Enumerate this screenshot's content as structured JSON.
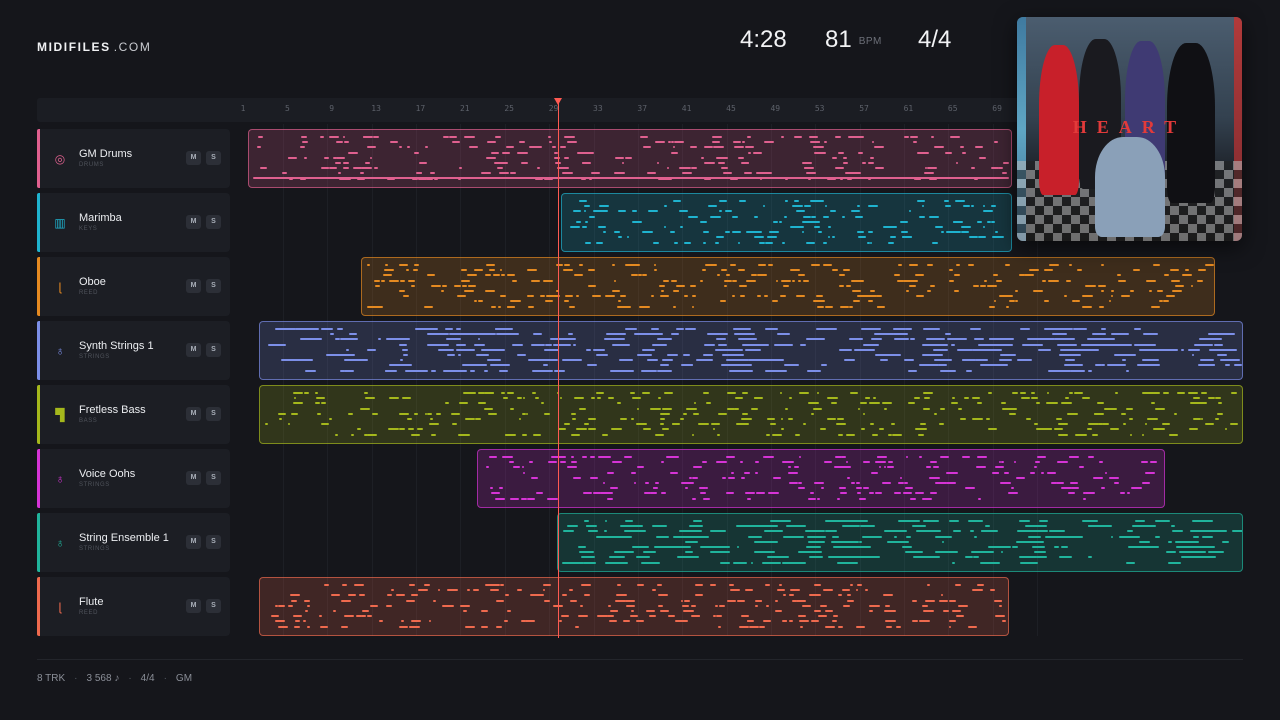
{
  "brand": {
    "name": "MIDIFILES",
    "domain": ".COM"
  },
  "header": {
    "time": "4:28",
    "bpm": "81",
    "bpm_unit": "BPM",
    "time_signature": "4/4"
  },
  "album": {
    "title": "HEART"
  },
  "ruler": {
    "bars": [
      "1",
      "5",
      "9",
      "13",
      "17",
      "21",
      "25",
      "29",
      "33",
      "37",
      "41",
      "45",
      "49",
      "53",
      "57",
      "61",
      "65",
      "69"
    ]
  },
  "playhead_bar": 29,
  "tracks": [
    {
      "name": "GM Drums",
      "category": "DRUMS",
      "color": "#e0608f",
      "icon": "drum-icon",
      "mute": "M",
      "solo": "S",
      "regions": [
        [
          0.008,
          0.77
        ]
      ]
    },
    {
      "name": "Marimba",
      "category": "KEYS",
      "color": "#1fb3cf",
      "icon": "keyboard-icon",
      "mute": "M",
      "solo": "S",
      "regions": [
        [
          0.32,
          0.77
        ]
      ]
    },
    {
      "name": "Oboe",
      "category": "REED",
      "color": "#e58a21",
      "icon": "reed-icon",
      "mute": "M",
      "solo": "S",
      "regions": [
        [
          0.121,
          0.972
        ]
      ]
    },
    {
      "name": "Synth Strings 1",
      "category": "STRINGS",
      "color": "#7c8fe8",
      "icon": "violin-icon",
      "mute": "M",
      "solo": "S",
      "regions": [
        [
          0.019,
          1.0
        ]
      ]
    },
    {
      "name": "Fretless Bass",
      "category": "BASS",
      "color": "#a5b81c",
      "icon": "bass-icon",
      "mute": "M",
      "solo": "S",
      "regions": [
        [
          0.019,
          1.0
        ]
      ]
    },
    {
      "name": "Voice Oohs",
      "category": "STRINGS",
      "color": "#d634d6",
      "icon": "voice-icon",
      "mute": "M",
      "solo": "S",
      "regions": [
        [
          0.236,
          0.922
        ]
      ]
    },
    {
      "name": "String Ensemble 1",
      "category": "STRINGS",
      "color": "#20b49c",
      "icon": "strings-icon",
      "mute": "M",
      "solo": "S",
      "regions": [
        [
          0.316,
          1.0
        ]
      ]
    },
    {
      "name": "Flute",
      "category": "REED",
      "color": "#ef6a4e",
      "icon": "flute-icon",
      "mute": "M",
      "solo": "S",
      "regions": [
        [
          0.019,
          0.767
        ]
      ]
    }
  ],
  "footer": {
    "tracks": "8 TRK",
    "notes": "3 568 ♪",
    "signature": "4/4",
    "standard": "GM"
  },
  "colors": {
    "background": "#15161b",
    "playhead": "#ff5a52"
  }
}
